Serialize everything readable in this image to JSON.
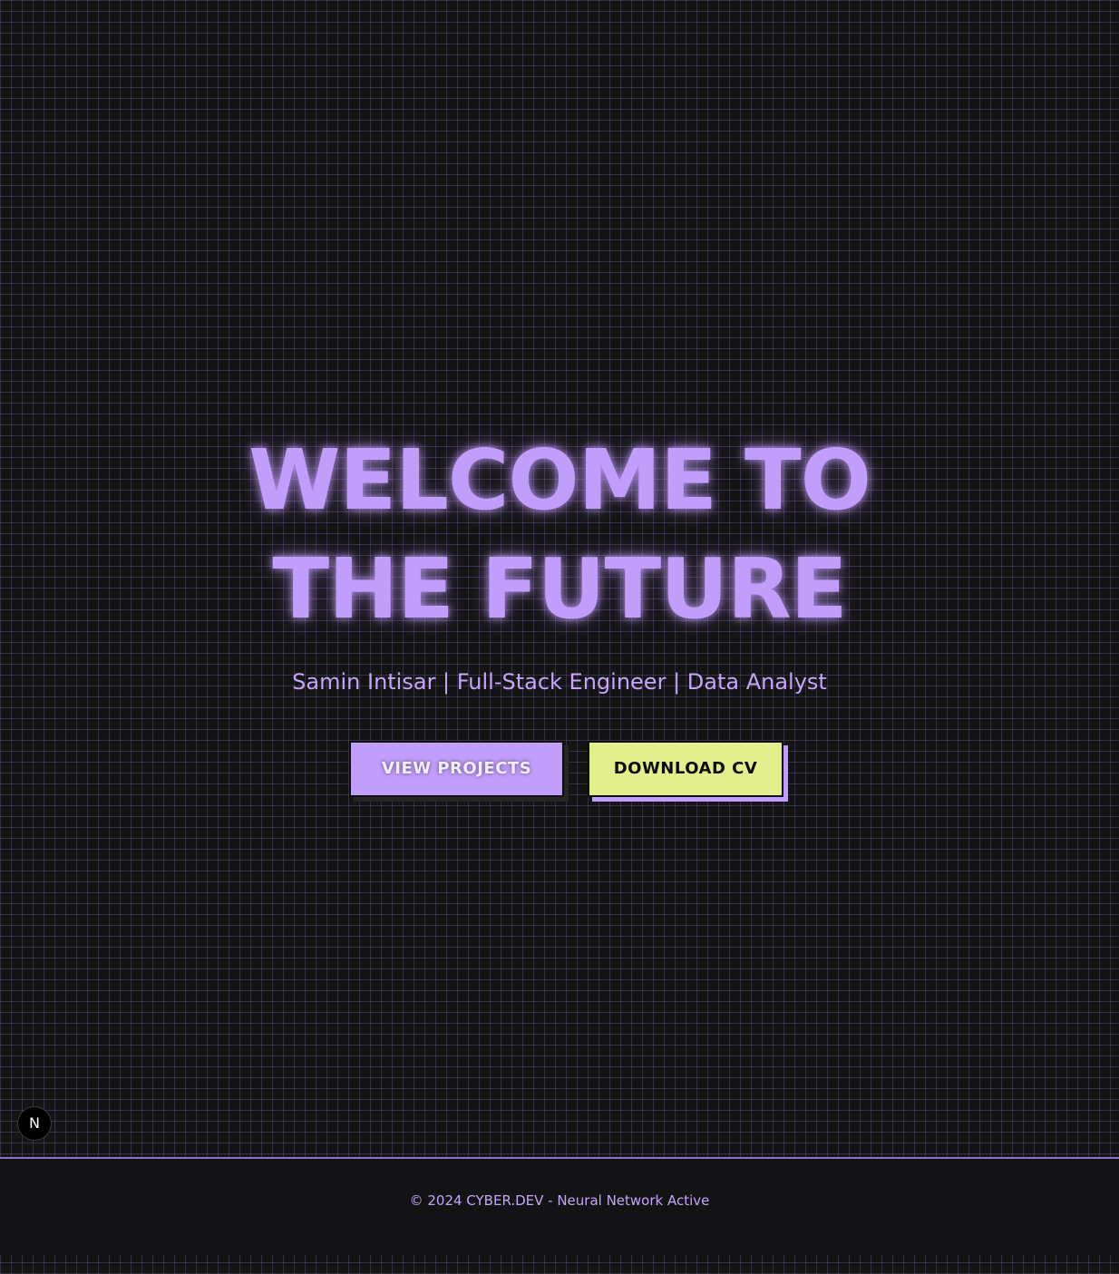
{
  "hero": {
    "title_line1": "WELCOME TO",
    "title_line2": "THE FUTURE",
    "subtitle": "Samin Intisar | Full-Stack Engineer | Data Analyst"
  },
  "buttons": {
    "view_projects": "VIEW PROJECTS",
    "download_cv": "DOWNLOAD CV"
  },
  "badge": {
    "letter": "N",
    "icon": "nextjs-logo-icon"
  },
  "footer": {
    "text": "© 2024 CYBER.DEV - Neural Network Active"
  },
  "colors": {
    "accent_purple": "#c19dfc",
    "accent_lime": "#e2ef8c",
    "background": "#141414",
    "footer_background": "#131316"
  }
}
